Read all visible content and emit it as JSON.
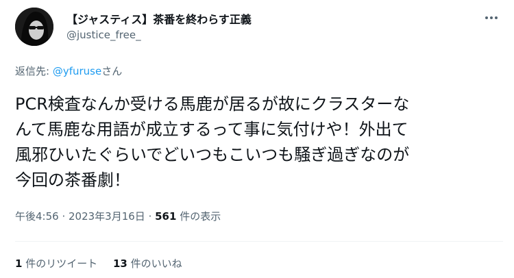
{
  "author": {
    "display_name": "【ジャスティス】茶番を終わらす正義",
    "username": "@justice_free_"
  },
  "reply": {
    "prefix": "返信先: ",
    "mention": "@yfuruse",
    "suffix": "さん"
  },
  "tweet": {
    "text": "PCR検査なんか受ける馬鹿が居るが故にクラスターな\nんて馬鹿な用語が成立するって事に気付けや！外出て\n風邪ひいたぐらいでどいつもこいつも騒ぎ過ぎなのが\n今回の茶番劇！"
  },
  "meta": {
    "time": "午後4:56",
    "separator1": " · ",
    "date": "2023年3月16日",
    "separator2": " · ",
    "views_count": "561",
    "views_label": " 件の表示"
  },
  "stats": {
    "retweets_count": "1",
    "retweets_label": " 件のリツイート",
    "likes_count": "13",
    "likes_label": " 件のいいね"
  },
  "icons": {
    "more": "more-dots-icon"
  },
  "colors": {
    "link": "#1d9bf0",
    "secondary_text": "#536471",
    "primary_text": "#0f1419"
  }
}
